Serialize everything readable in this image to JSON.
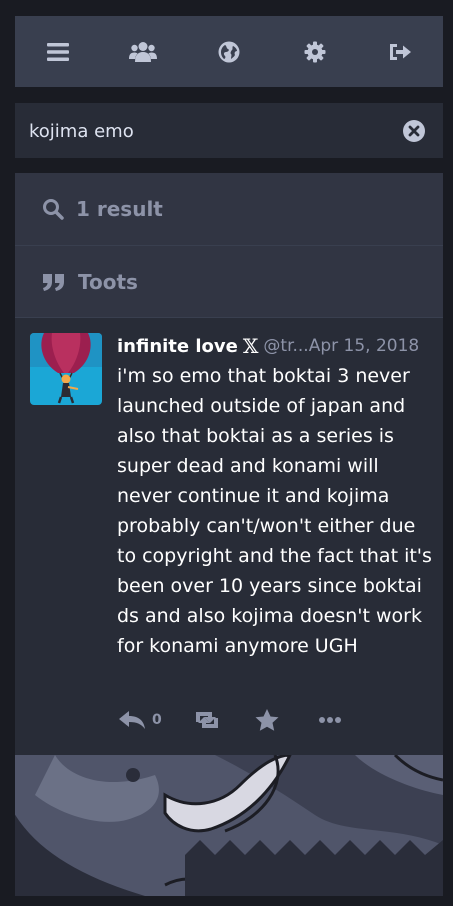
{
  "nav": {
    "items": [
      {
        "name": "menu",
        "icon": "bars-icon"
      },
      {
        "name": "local",
        "icon": "users-icon"
      },
      {
        "name": "federated",
        "icon": "globe-icon"
      },
      {
        "name": "preferences",
        "icon": "gear-icon"
      },
      {
        "name": "logout",
        "icon": "sign-out-icon"
      }
    ]
  },
  "search": {
    "value": "kojima emo",
    "clear_icon": "times-circle-icon"
  },
  "results": {
    "count_label": "1 result",
    "section_label": "Toots"
  },
  "status": {
    "display_name": "infinite love",
    "badge": "𝕏",
    "acct": "@tr...",
    "timestamp": "Apr 15, 2018",
    "content": "i'm so emo that boktai 3 never launched outside of japan and also that boktai as a series is super dead and konami will never continue it and kojima probably can't/won't either due to copyright and the fact that it's been over 10 years since boktai ds and also kojima doesn't work for konami anymore UGH",
    "reply_count": "0"
  },
  "colors": {
    "background": "#191b22",
    "panel": "#282c37",
    "header": "#393f4f",
    "muted_text": "#8d93a8",
    "text": "#ffffff"
  }
}
